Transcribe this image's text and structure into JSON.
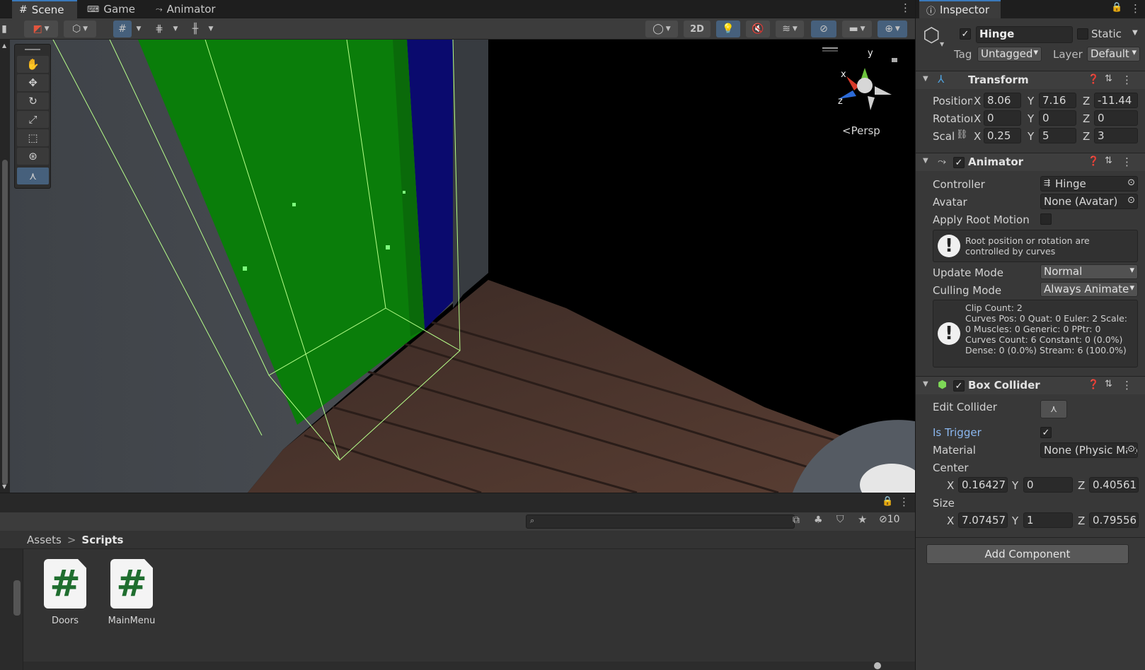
{
  "tabs": {
    "scene": "Scene",
    "game": "Game",
    "animator": "Animator"
  },
  "scene_toolbar": {
    "mode_2d": "2D"
  },
  "scene_view": {
    "projection_label": "Persp",
    "gizmo_y": "y",
    "gizmo_x": "x",
    "gizmo_z": "z"
  },
  "project": {
    "hidden_count": "10",
    "breadcrumb": {
      "root": "Assets",
      "separator": ">",
      "current": "Scripts"
    },
    "files": [
      {
        "name": "Doors",
        "glyph": "#"
      },
      {
        "name": "MainMenu",
        "glyph": "#"
      }
    ]
  },
  "inspector": {
    "tab_label": "Inspector",
    "object_name": "Hinge",
    "static_label": "Static",
    "tag_label": "Tag",
    "tag_value": "Untagged",
    "layer_label": "Layer",
    "layer_value": "Default",
    "transform": {
      "title": "Transform",
      "position_label": "Position",
      "rotation_label": "Rotation",
      "scale_label": "Scale",
      "position": {
        "x": "8.06",
        "y": "7.16",
        "z": "-11.44"
      },
      "rotation": {
        "x": "0",
        "y": "0",
        "z": "0"
      },
      "scale": {
        "x": "0.25",
        "y": "5",
        "z": "3"
      }
    },
    "animator": {
      "title": "Animator",
      "controller_label": "Controller",
      "controller_value": "Hinge",
      "avatar_label": "Avatar",
      "avatar_value": "None (Avatar)",
      "apply_root_motion_label": "Apply Root Motion",
      "root_help_line1": "Root position or rotation are",
      "root_help_line2": "controlled by curves",
      "update_mode_label": "Update Mode",
      "update_mode_value": "Normal",
      "culling_mode_label": "Culling Mode",
      "culling_mode_value": "Always Animate",
      "info_lines": [
        "Clip Count: 2",
        "Curves Pos: 0 Quat: 0 Euler: 2 Scale:",
        "0 Muscles: 0 Generic: 0 PPtr: 0",
        "Curves Count: 6 Constant: 0 (0.0%)",
        "Dense: 0 (0.0%) Stream: 6 (100.0%)"
      ]
    },
    "box_collider": {
      "title": "Box Collider",
      "edit_collider_label": "Edit Collider",
      "is_trigger_label": "Is Trigger",
      "is_trigger": true,
      "material_label": "Material",
      "material_value": "None (Physic Material)",
      "center_label": "Center",
      "center": {
        "x": "0.16427",
        "y": "0",
        "z": "0.40561"
      },
      "size_label": "Size",
      "size": {
        "x": "7.07457",
        "y": "1",
        "z": "0.79556"
      }
    },
    "add_component_label": "Add Component"
  },
  "colors": {
    "accent": "#3a79bb",
    "active_tool": "#46607c",
    "trigger_label": "#8bb7ef",
    "door_green": "#0a7d0a"
  }
}
